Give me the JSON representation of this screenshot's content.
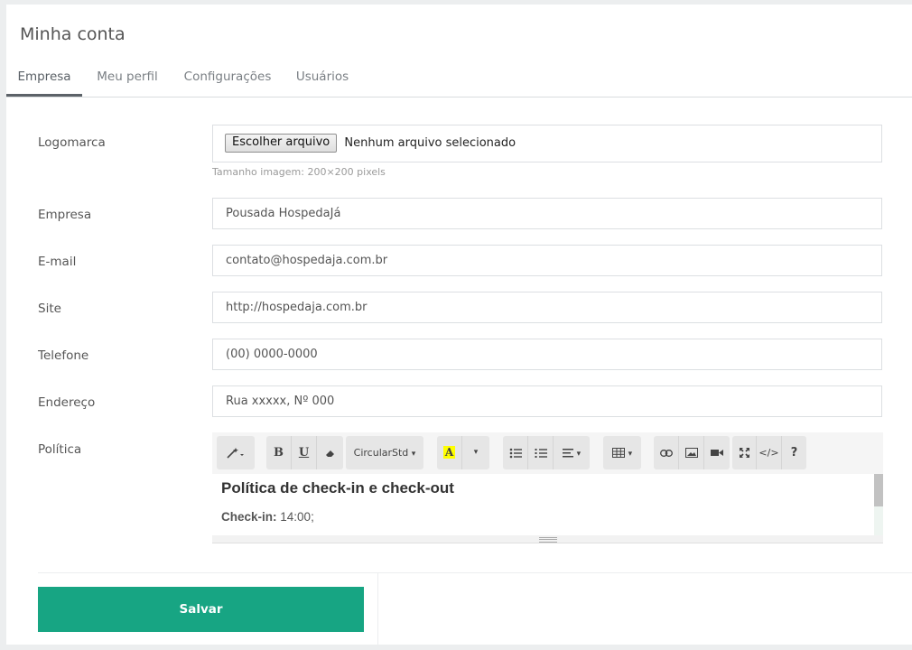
{
  "page": {
    "title": "Minha conta"
  },
  "tabs": [
    {
      "label": "Empresa",
      "active": true
    },
    {
      "label": "Meu perfil",
      "active": false
    },
    {
      "label": "Configurações",
      "active": false
    },
    {
      "label": "Usuários",
      "active": false
    }
  ],
  "form": {
    "logo": {
      "label": "Logomarca",
      "button": "Escolher arquivo",
      "status": "Nenhum arquivo selecionado",
      "hint": "Tamanho imagem: 200×200 pixels"
    },
    "empresa": {
      "label": "Empresa",
      "value": "Pousada HospedaJá"
    },
    "email": {
      "label": "E-mail",
      "value": "contato@hospedaja.com.br"
    },
    "site": {
      "label": "Site",
      "value": "http://hospedaja.com.br"
    },
    "telefone": {
      "label": "Telefone",
      "value": "(00)  0000-0000"
    },
    "endereco": {
      "label": "Endereço",
      "value": "Rua xxxxx, Nº 000"
    },
    "politica": {
      "label": "Política",
      "toolbar": {
        "style_icon": "magic-wand-icon",
        "bold": "B",
        "underline": "U",
        "clear_icon": "eraser-icon",
        "font_name": "CircularStd",
        "color_letter": "A",
        "color_dropdown": "▾",
        "ul_icon": "unordered-list-icon",
        "ol_icon": "ordered-list-icon",
        "align_icon": "align-icon",
        "table_icon": "table-icon",
        "link_icon": "link-icon",
        "picture_icon": "picture-icon",
        "video_icon": "video-icon",
        "fullscreen_icon": "fullscreen-icon",
        "code_view": "</>",
        "help": "?"
      },
      "content_heading": "Política de check-in e check-out",
      "content_line_label": "Check-in:",
      "content_line_value": "14:00;"
    }
  },
  "actions": {
    "save": "Salvar"
  },
  "colors": {
    "accent": "#17a583",
    "highlight": "#ffff00"
  }
}
